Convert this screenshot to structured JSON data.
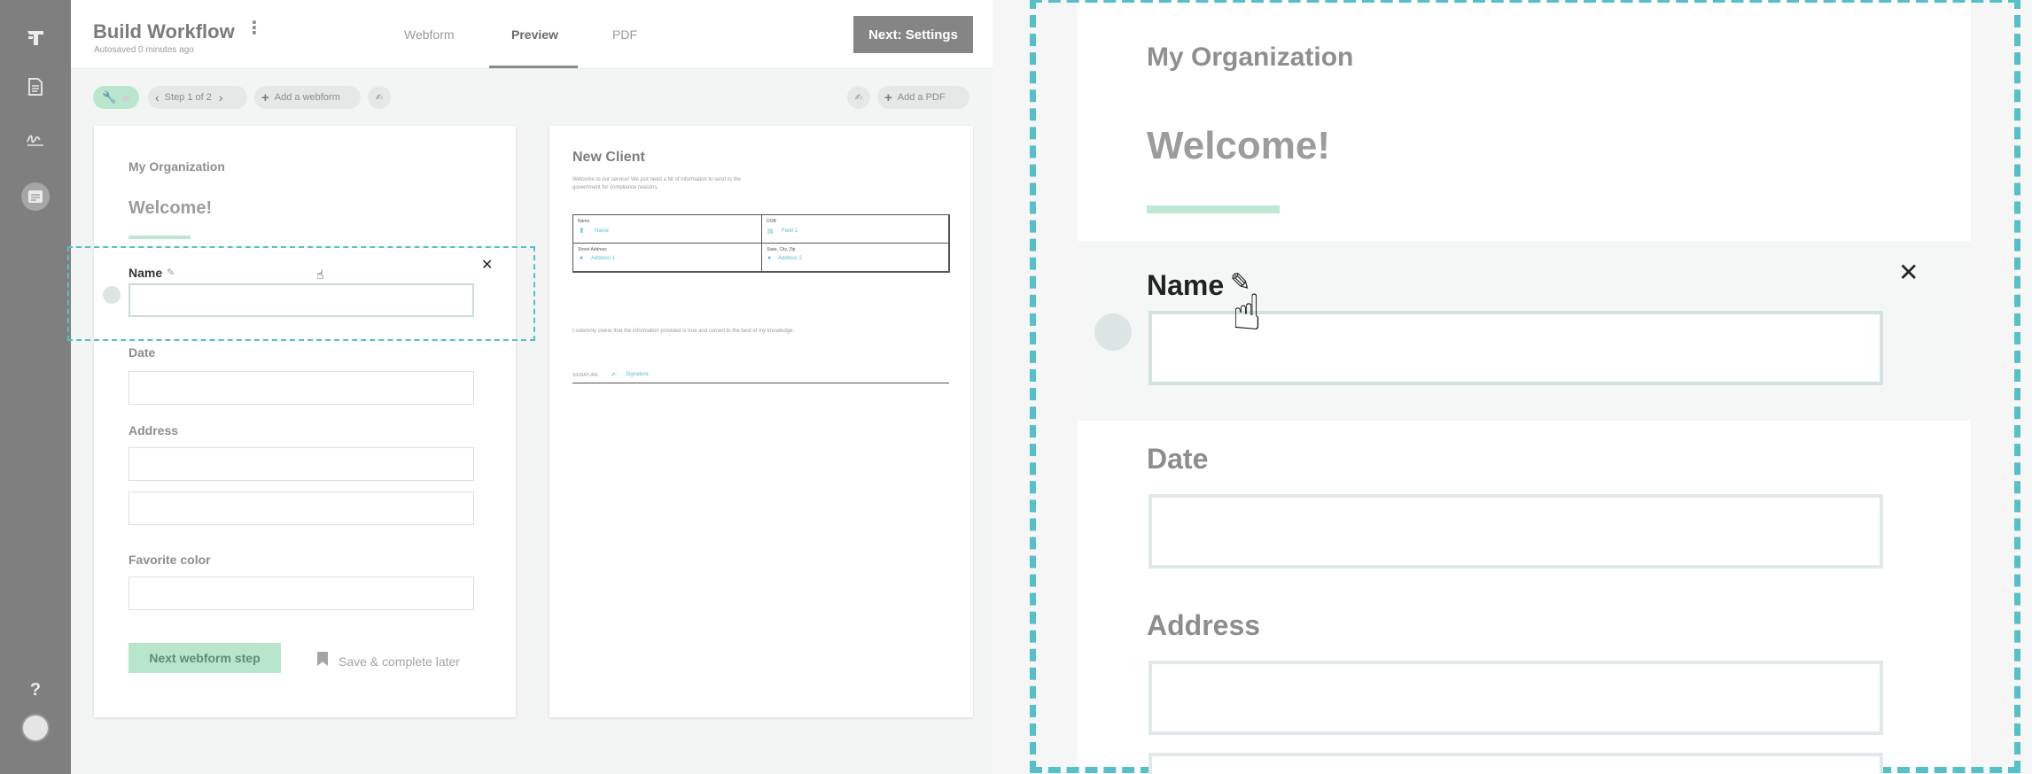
{
  "app": {
    "title": "Build Workflow",
    "autosave": "Autosaved 0 minutes ago",
    "tabs": [
      "Webform",
      "Preview",
      "PDF"
    ],
    "active_tab": "Preview",
    "next_button": "Next: Settings"
  },
  "toolbar": {
    "step": "Step 1 of 2",
    "add_webform": "Add a webform",
    "add_pdf": "Add a PDF"
  },
  "webform": {
    "organization": "My Organization",
    "heading": "Welcome!",
    "fields": [
      {
        "label": "Name",
        "selected": true
      },
      {
        "label": "Date"
      },
      {
        "label": "Address"
      },
      {
        "label": "Favorite color"
      }
    ],
    "submit": "Next webform step",
    "save_later": "Save & complete later"
  },
  "pdf": {
    "title": "New Client",
    "intro": "Welcome to our service! We just need a bit of information to send to the government for compliance reasons.",
    "cells": [
      {
        "label": "Name",
        "field": "Name"
      },
      {
        "label": "DOB",
        "field": "Field 1"
      },
      {
        "label": "Street Address",
        "field": "Address 1"
      },
      {
        "label": "State, City, Zip",
        "field": "Address 2"
      }
    ],
    "attestation": "I solemnly swear that the information provided is true and correct to the best of my knowledge.",
    "signature_label": "SIGNATURE",
    "signature_field": "Signature"
  },
  "zoom": {
    "organization": "My Organization",
    "heading": "Welcome!",
    "fields": [
      "Name",
      "Date",
      "Address"
    ]
  },
  "colors": {
    "accent_teal": "#55c0c8",
    "accent_green": "#b8e6cd",
    "rail": "#7f7f7f"
  }
}
